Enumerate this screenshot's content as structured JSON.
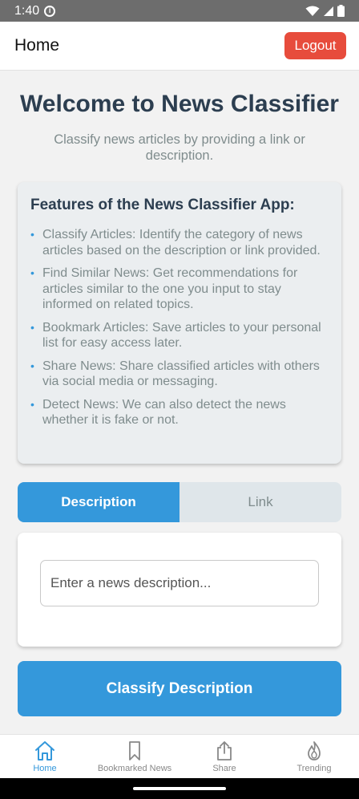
{
  "status_bar": {
    "time": "1:40"
  },
  "header": {
    "title": "Home",
    "logout_label": "Logout"
  },
  "welcome": {
    "title": "Welcome to News Classifier",
    "subtitle": "Classify news articles by providing a link or description."
  },
  "features": {
    "heading": "Features of the News Classifier App:",
    "items": [
      "Classify Articles: Identify the category of news articles based on the description or link provided.",
      "Find Similar News: Get recommendations for articles similar to the one you input to stay informed on related topics.",
      "Bookmark Articles: Save articles to your personal list for easy access later.",
      "Share News: Share classified articles with others via social media or messaging.",
      "Detect News: We can also detect the news whether it is fake or not."
    ]
  },
  "tabs": {
    "description": "Description",
    "link": "Link"
  },
  "input": {
    "placeholder": "Enter a news description..."
  },
  "classify_button": "Classify Description",
  "bottom_nav": {
    "home": "Home",
    "bookmarked": "Bookmarked News",
    "share": "Share",
    "trending": "Trending"
  },
  "colors": {
    "accent": "#3498db",
    "logout": "#e74c3c",
    "title": "#2c3e50",
    "muted": "#7f8c8d"
  }
}
